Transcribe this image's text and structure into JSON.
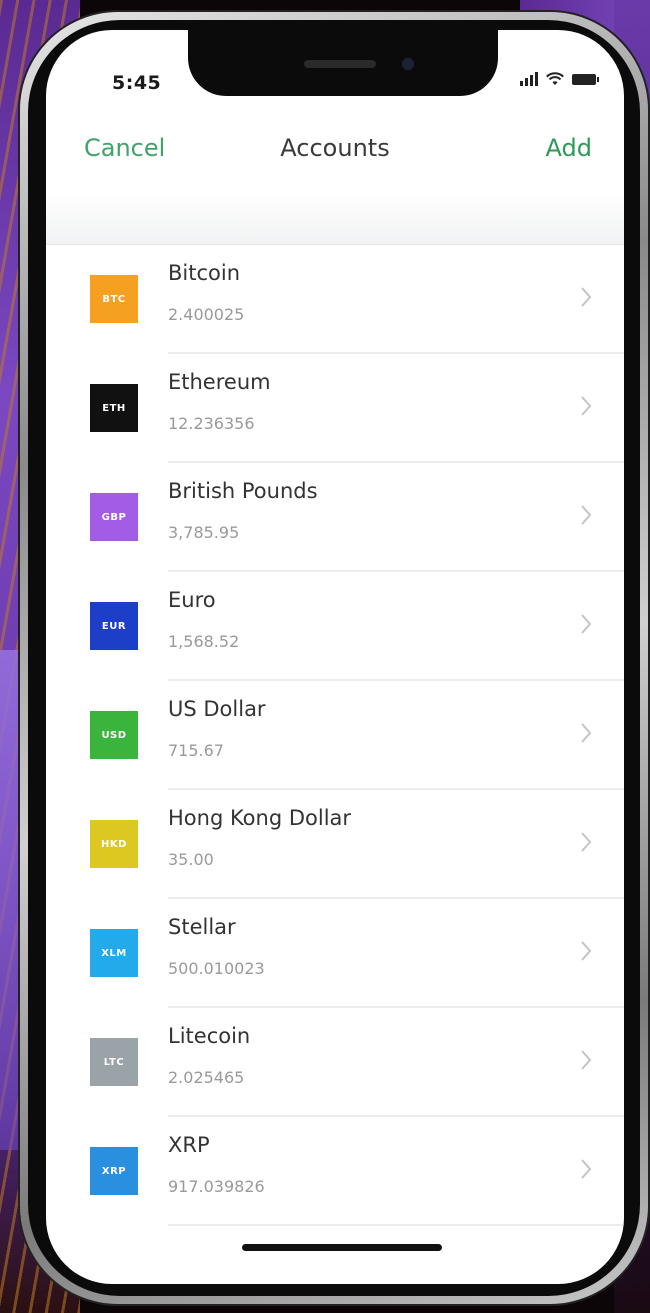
{
  "status_bar": {
    "time": "5:45"
  },
  "navbar": {
    "cancel_label": "Cancel",
    "title": "Accounts",
    "add_label": "Add"
  },
  "accounts": [
    {
      "code": "BTC",
      "name": "Bitcoin",
      "amount": "2.400025",
      "color": "#f5a020"
    },
    {
      "code": "ETH",
      "name": "Ethereum",
      "amount": "12.236356",
      "color": "#111111"
    },
    {
      "code": "GBP",
      "name": "British Pounds",
      "amount": "3,785.95",
      "color": "#a35ce6"
    },
    {
      "code": "EUR",
      "name": "Euro",
      "amount": "1,568.52",
      "color": "#1d3fc8"
    },
    {
      "code": "USD",
      "name": "US Dollar",
      "amount": "715.67",
      "color": "#3ab43c"
    },
    {
      "code": "HKD",
      "name": "Hong Kong Dollar",
      "amount": "35.00",
      "color": "#dcc820"
    },
    {
      "code": "XLM",
      "name": "Stellar",
      "amount": "500.010023",
      "color": "#22aaea"
    },
    {
      "code": "LTC",
      "name": "Litecoin",
      "amount": "2.025465",
      "color": "#9aa3a8"
    },
    {
      "code": "XRP",
      "name": "XRP",
      "amount": "917.039826",
      "color": "#2b8fe0"
    }
  ],
  "colors": {
    "accent": "#2e9a58",
    "cancel": "#3fa36a"
  }
}
